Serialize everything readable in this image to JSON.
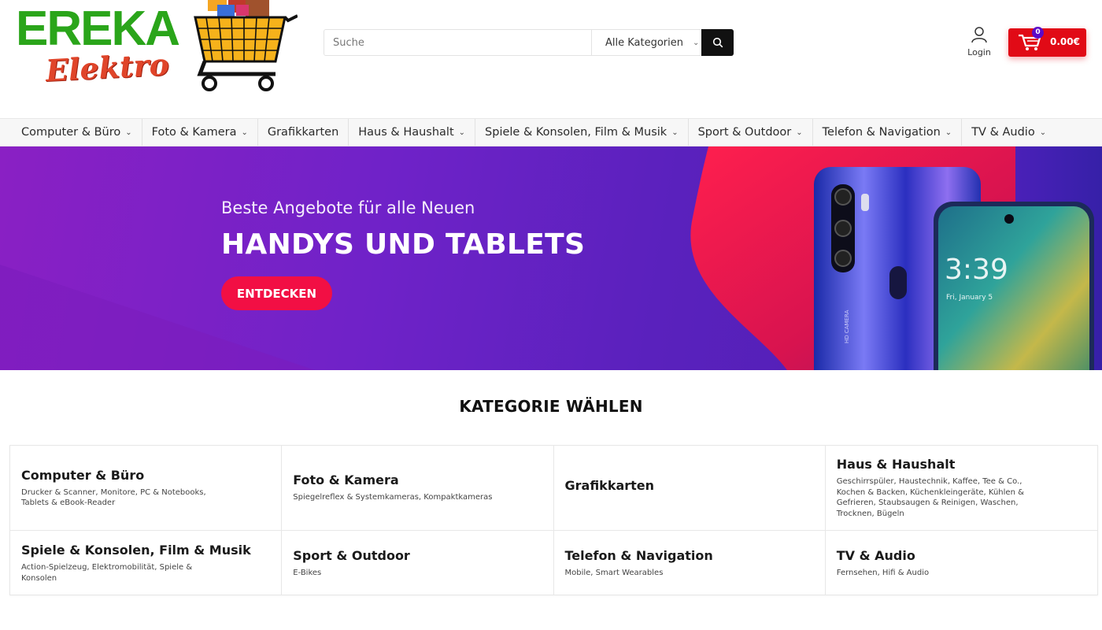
{
  "brand": {
    "name_top": "EREKA",
    "name_bottom": "Elektro"
  },
  "search": {
    "placeholder": "Suche",
    "category_label": "Alle Kategorien"
  },
  "account": {
    "login_label": "Login"
  },
  "cart": {
    "count": "0",
    "total": "0.00€"
  },
  "nav": {
    "items": [
      {
        "label": "Computer & Büro",
        "has_dropdown": true
      },
      {
        "label": "Foto & Kamera",
        "has_dropdown": true
      },
      {
        "label": "Grafikkarten",
        "has_dropdown": false
      },
      {
        "label": "Haus & Haushalt",
        "has_dropdown": true
      },
      {
        "label": "Spiele & Konsolen, Film & Musik",
        "has_dropdown": true
      },
      {
        "label": "Sport & Outdoor",
        "has_dropdown": true
      },
      {
        "label": "Telefon & Navigation",
        "has_dropdown": true
      },
      {
        "label": "TV & Audio",
        "has_dropdown": true
      }
    ]
  },
  "hero": {
    "subtitle": "Beste Angebote für alle Neuen",
    "title": "HANDYS UND TABLETS",
    "button_label": "ENTDECKEN",
    "phone_back_text": "HD CAMERA",
    "phone_front_time": "3:39",
    "phone_front_date": "Fri, January 5"
  },
  "categories": {
    "heading": "KATEGORIE WÄHLEN",
    "items": [
      {
        "title": "Computer & Büro",
        "desc": "Drucker & Scanner, Monitore, PC & Notebooks, Tablets & eBook-Reader"
      },
      {
        "title": "Foto & Kamera",
        "desc": "Spiegelreflex & Systemkameras, Kompaktkameras"
      },
      {
        "title": "Grafikkarten",
        "desc": ""
      },
      {
        "title": "Haus & Haushalt",
        "desc": "Geschirrspüler, Haustechnik, Kaffee, Tee & Co., Kochen & Backen, Küchenkleingeräte, Kühlen & Gefrieren, Staubsaugen & Reinigen, Waschen, Trocknen, Bügeln"
      },
      {
        "title": "Spiele & Konsolen, Film & Musik",
        "desc": "Action-Spielzeug, Elektromobilität, Spiele & Konsolen"
      },
      {
        "title": "Sport & Outdoor",
        "desc": "E-Bikes"
      },
      {
        "title": "Telefon & Navigation",
        "desc": "Mobile, Smart Wearables"
      },
      {
        "title": "TV & Audio",
        "desc": "Fernsehen, Hifi & Audio"
      }
    ]
  },
  "colors": {
    "brand_green": "#2aa51a",
    "brand_red": "#e0452a",
    "cart_red": "#e10a16",
    "hero_button": "#f20f44",
    "hero_purple": "#6f22c8"
  }
}
